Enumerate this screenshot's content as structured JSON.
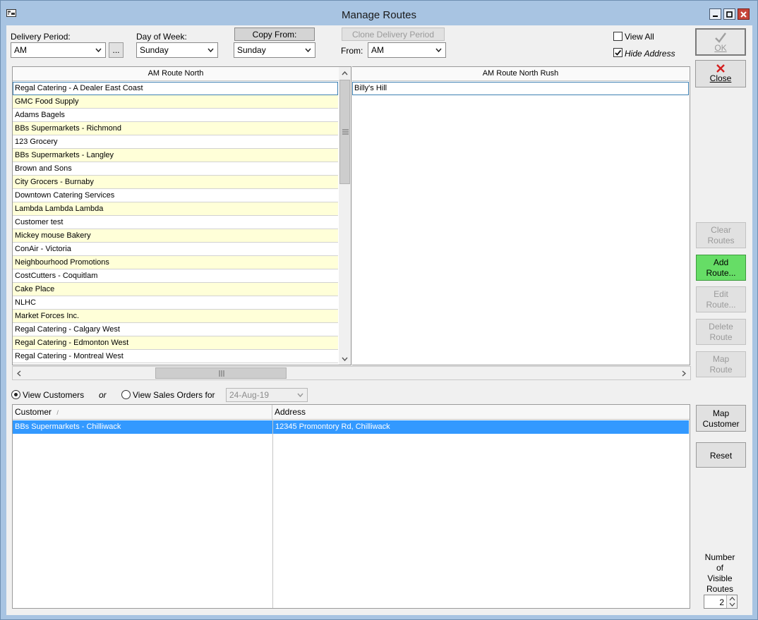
{
  "window": {
    "title": "Manage Routes"
  },
  "top": {
    "delivery_period_label": "Delivery Period:",
    "delivery_period_value": "AM",
    "ellipsis_label": "...",
    "day_of_week_label": "Day of Week:",
    "day_of_week_value": "Sunday",
    "copy_from_label": "Copy From:",
    "copy_from_value": "Sunday",
    "clone_label": "Clone Delivery Period",
    "from_label": "From:",
    "from_value": "AM",
    "view_all_label": "View All",
    "view_all_checked": false,
    "hide_address_label": "Hide Address",
    "hide_address_checked": true
  },
  "buttons": {
    "ok": "OK",
    "close": "Close",
    "clear_routes_1": "Clear",
    "clear_routes_2": "Routes",
    "add_route_1": "Add",
    "add_route_2": "Route...",
    "edit_route_1": "Edit",
    "edit_route_2": "Route...",
    "delete_route_1": "Delete",
    "delete_route_2": "Route",
    "map_route_1": "Map",
    "map_route_2": "Route",
    "map_customer_1": "Map",
    "map_customer_2": "Customer",
    "reset": "Reset"
  },
  "routes": [
    {
      "name": "AM Route North",
      "stops": [
        "Regal Catering - A Dealer East Coast",
        "GMC Food Supply",
        "Adams Bagels",
        "BBs Supermarkets - Richmond",
        "123 Grocery",
        "BBs Supermarkets - Langley",
        "Brown and Sons",
        "City Grocers - Burnaby",
        "Downtown Catering Services",
        "Lambda Lambda Lambda",
        "Customer test",
        "Mickey mouse Bakery",
        "ConAir - Victoria",
        "Neighbourhood Promotions",
        "CostCutters - Coquitlam",
        "Cake Place",
        "NLHC",
        "Market Forces Inc.",
        "Regal Catering - Calgary West",
        "Regal Catering - Edmonton West",
        "Regal Catering - Montreal West"
      ]
    },
    {
      "name": "AM Route North Rush",
      "stops": [
        "Billy's Hill"
      ]
    }
  ],
  "view": {
    "view_customers_label": "View Customers",
    "view_customers_selected": true,
    "or_label": "or",
    "view_sales_orders_label": "View Sales Orders for",
    "date_value": "24-Aug-19"
  },
  "customers_grid": {
    "columns": [
      "Customer",
      "Address"
    ],
    "rows": [
      {
        "customer": "BBs Supermarkets - Chilliwack",
        "address": "12345 Promontory Rd, Chilliwack"
      }
    ]
  },
  "visible_routes": {
    "label_1": "Number",
    "label_2": "of",
    "label_3": "Visible",
    "label_4": "Routes",
    "value": "2"
  }
}
